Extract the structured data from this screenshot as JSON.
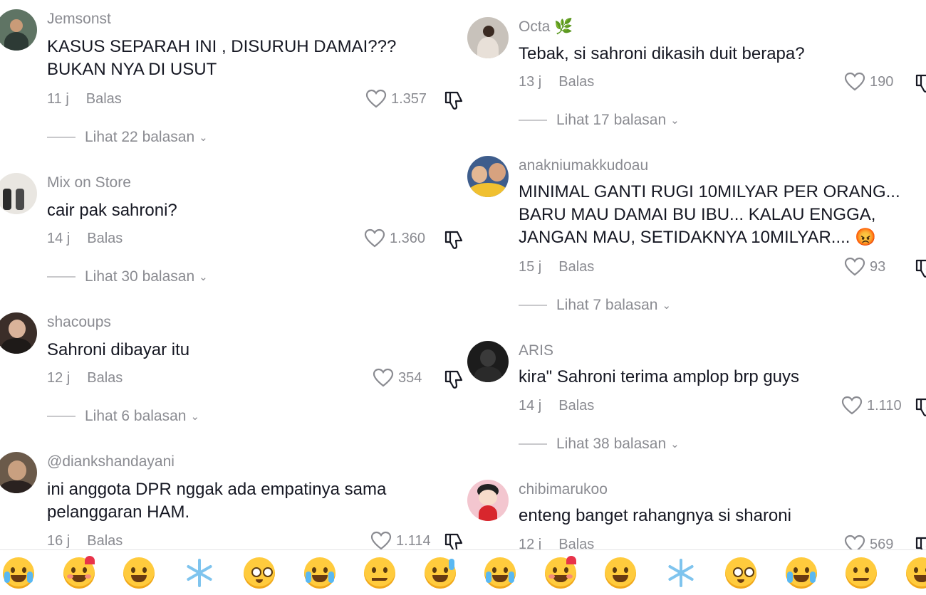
{
  "left_comments": [
    {
      "user": "Jemsonst",
      "text": "KASUS SEPARAH INI , DISURUH DAMAI???\nBUKAN NYA DI USUT",
      "time": "11 j",
      "reply": "Balas",
      "likes": "1.357",
      "view_replies": "Lihat 22 balasan"
    },
    {
      "user": "Mix on Store",
      "text": "cair pak sahroni?",
      "time": "14 j",
      "reply": "Balas",
      "likes": "1.360",
      "view_replies": "Lihat 30 balasan"
    },
    {
      "user": "shacoups",
      "text": "Sahroni dibayar itu",
      "time": "12 j",
      "reply": "Balas",
      "likes": "354",
      "view_replies": "Lihat 6 balasan"
    },
    {
      "user": "@diankshandayani",
      "text": "ini anggota DPR nggak ada empatinya sama\npelanggaran HAM.",
      "time": "16 j",
      "reply": "Balas",
      "likes": "1.114",
      "view_replies": ""
    }
  ],
  "right_comments": [
    {
      "user": "Octa 🌿",
      "text": "Tebak, si sahroni dikasih duit berapa?",
      "time": "13 j",
      "reply": "Balas",
      "likes": "190",
      "view_replies": "Lihat 17 balasan"
    },
    {
      "user": "anakniumakkudoau",
      "text": "MINIMAL GANTI RUGI 10MILYAR PER ORANG...\nBARU MAU DAMAI BU IBU... KALAU ENGGA,\nJANGAN MAU, SETIDAKNYA 10MILYAR.... 😡",
      "time": "15 j",
      "reply": "Balas",
      "likes": "93",
      "view_replies": "Lihat 7 balasan"
    },
    {
      "user": "ARIS",
      "text": "kira\" Sahroni terima amplop brp guys",
      "time": "14 j",
      "reply": "Balas",
      "likes": "1.110",
      "view_replies": "Lihat 38 balasan"
    },
    {
      "user": "chibimarukoo",
      "text": "enteng banget rahangnya si sharoni",
      "time": "12 j",
      "reply": "Balas",
      "likes": "569",
      "view_replies": ""
    }
  ],
  "emoji_bar": [
    "loudly-crying-face",
    "smiling-face-with-hearts",
    "grinning-face",
    "snowflake",
    "flushed-face",
    "face-with-tears-of-joy",
    "smirking-face",
    "grinning-face-with-sweat",
    "loudly-crying-face",
    "smiling-face-with-hearts",
    "grinning-face",
    "snowflake",
    "flushed-face",
    "face-with-tears-of-joy",
    "smirking-face",
    "grinning-face-with-sweat"
  ],
  "colors": {
    "text": "#161823",
    "muted": "#8a8b91",
    "background": "#ffffff"
  }
}
